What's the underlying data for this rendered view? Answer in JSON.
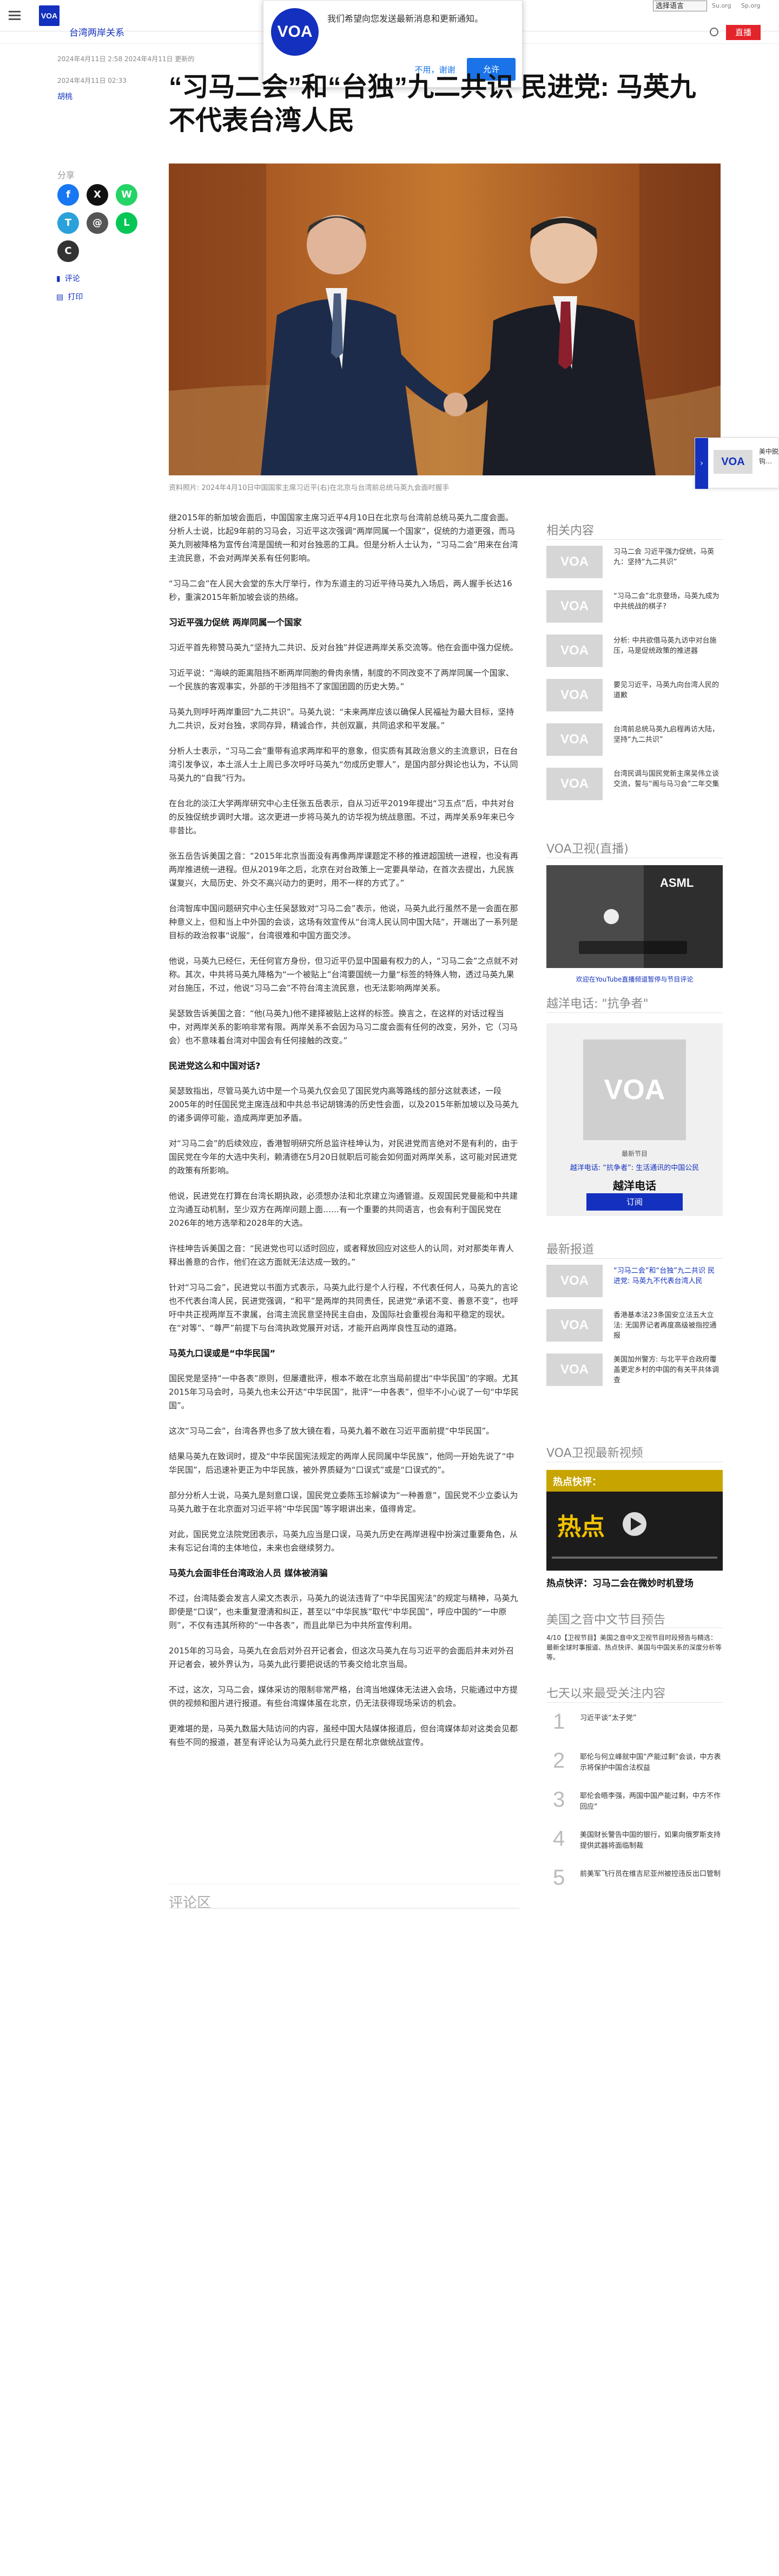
{
  "header": {
    "logo": "VOA",
    "section": "台湾两岸关系",
    "language_select": "选择语言",
    "lang_alt": "Su.org",
    "lang_alt2": "Sp.org",
    "live_label": "直播"
  },
  "popup": {
    "logo": "VOA",
    "message": "我们希望向您发送最新消息和更新通知。",
    "decline": "不用，谢谢",
    "accept": "允许"
  },
  "article": {
    "updated": "2024年4月11日 2:58 2024年4月11日 更新的",
    "published": "2024年4月11日 02:33",
    "byline": "胡桃",
    "headline": "“习马二会”和“台独”九二共识 民进党: 马英九不代表台湾人民",
    "caption": "资料照片: 2024年4月10日中国国家主席习近平(右)在北京与台湾前总统马英九会面时握手",
    "paragraphs": [
      "继2015年的新加坡会面后，中国国家主席习近平4月10日在北京与台湾前总统马英九二度会面。分析人士说，比起9年前的习马会，习近平这次强调“两岸同属一个国家”，促统的力道更强，而马英九则被降格为宣传台湾是国统一和对台独恶的工具。但是分析人士认为，“习马二会”用来在台湾主流民意，不会对两岸关系有任何影响。",
      "“习马二会”在人民大会堂的东大厅举行，作为东道主的习近平待马英九入场后，两人握手长达16秒，重演2015年新加坡会谈的热络。"
    ],
    "section1_title": "习近平强力促统 两岸同属一个国家",
    "section1_paragraphs": [
      "习近平首先称赞马英九“坚持九二共识、反对台独”并促进两岸关系交流等。他在会面中强力促统。",
      "习近平说：“海峡的距离阻挡不断两岸同胞的骨肉亲情，制度的不同改变不了两岸同属一个国家、一个民族的客观事实，外部的干涉阻挡不了家国团圆的历史大势。”",
      "马英九则呼吁两岸重回“九二共识”。马英九说：“未来两岸应该以确保人民福祉为最大目标，坚持九二共识，反对台独，求同存异，精诚合作，共创双赢，共同追求和平发展。”",
      "分析人士表示，“习马二会”重带有追求两岸和平的意象，但实质有其政治意义的主流意识，日在台湾引发争议，本土派人士上周已多次呼吁马英九“勿成历史罪人”，是国内部分舆论也认为，不认同马英九的“自我”行为。",
      "在台北的淡江大学两岸研究中心主任张五岳表示，自从习近平2019年提出“习五点”后，中共对台的反独促统步调时大增。这次更进一步将马英九的访华视为统战意图。不过，两岸关系9年来已今非昔比。",
      "张五岳告诉美国之音：“2015年北京当面没有再像两岸课题定不移的推进超国统一进程，也没有再两岸推进统一进程。但从2019年之后，北京在对台政策上一定要具举动，在首次去提出，九民族谋复兴，大局历史、外交不高兴动力的更时，用不一样的方式了。”",
      "台湾智库中国问题研究中心主任吴瑟致对“习马二会”表示，他说，马英九此行虽然不是一会面在那种意义上，但和当上中外国的会谈，这场有效宣传从“台湾人民认同中国大陆”，开端出了一系列是目标的政治叙事“说服”，台湾很难和中国方面交涉。",
      "他说，马英九已经仨，无任何官方身份，但习近平仍显中国最有权力的人，“习马二会”之点就不对称。其次，中共将马英九降格为“一个被贴上”台湾要国统一力量“标签的特殊人物，透过马英九果对台施压，不过，他说“习马二会”不符台湾主流民意，也无法影响两岸关系。",
      "吴瑟致告诉美国之音：“他(马英九)他不建择被贴上这样的标签。换言之，在这样的对话过程当中，对两岸关系的影响非常有限。两岸关系不会因为马习二度会面有任何的改变，另外，它（习马会）也不意味着台湾对中国会有任何接触的改变。”"
    ],
    "section2_title": "民进党这么和中国对话?",
    "section2_paragraphs": [
      "吴瑟致指出，尽管马英九访中是一个马英九仅会见了国民党内高等路线的部分这就表述，一段2005年的时任国民党主席连战和中共总书记胡锦涛的历史性会面，以及2015年新加坡以及马英九的诸多调停可能，造成两岸更加矛盾。",
      "对“习马二会”的后续效应，香港智明研究所总监许桂坤认为，对民进党而言绝对不是有利的，由于国民党在今年的大选中失利，赖清德在5月20日就职后可能会如何面对两岸关系，这可能对民进党的政策有所影响。",
      "他说，民进党在打算在台湾长期执政，必须想办法和北京建立沟通管道。反观国民党曼能和中共建立沟通互动机制，至少双方在两岸问题上面……有一个重要的共同语言，也会有利于国民党在2026年的地方选举和2028年的大选。",
      "许桂坤告诉美国之音：“民进党也可以适时回应，或者释放回应对这些人的认同，对对那类年青人释出善意的合作，他们在这方面就无法达成一致的。”",
      "针对“习马二会”，民进党以书面方式表示，马英九此行是个人行程，不代表任何人，马英九的言论也不代表台湾人民，民进党强调，“和平”是两岸的共同责任，民进党“承诺不变、善意不变”，也呼吁中共正视两岸互不隶属，台湾主流民意坚持民主自由，及国际社会重视台海和平稳定的现状。在“对等”、“尊严”前提下与台湾执政党展开对话，才能开启两岸良性互动的道路。"
    ],
    "section3_title": "马英九口误或是“中华民国”",
    "section3_paragraphs": [
      "国民党是坚持“一中各表”原则，但屡遭批评，根本不敢在北京当局前提出“中华民国”的字眼。尤其2015年习马会时，马英九也未公开达“中华民国”，批评“一中各表”，但毕不小心说了一句“中华民国”。",
      "这次“习马二会”，台湾各界也多了放大镜在看，马英九着不敢在习近平面前提“中华民国”。",
      "结果马英九在致词时，提及“中华民国宪法规定的两岸人民同属中华民族”，他同一开始先说了“中华民国”，后迅速补更正为中华民族，被外界质疑为“口误式”或是“口误式的”。",
      "部分分析人士说，马英九是刻意口误，国民党立委陈玉珍解读为“一种善意”，国民党不少立委认为马英九敢于在北京面对习近平将“中华民国”等字眼讲出来，值得肯定。",
      "对此，国民党立法院党团表示，马英九应当是口误，马英九历史在两岸进程中扮演过重要角色，从未有忘记台湾的主体地位，未来也会继续努力。"
    ],
    "section4_title": "马英九会面非任台湾政治人员 媒体被消骗",
    "section4_paragraphs": [
      "不过，台湾陆委会发言人梁文杰表示，马英九的说法违背了“中华民国宪法”的规定与精神，马英九即使是“口误”，也未重复澄清和纠正，甚至以“中华民族”取代“中华民国”，呼应中国的“一中原则”，不仅有违其所称的“一中各表”，而且此举已为中共所宣传利用。",
      "2015年的习马会，马英九在会后对外召开记者会，但这次马英九在与习近平的会面后并未对外召开记者会，被外界认为，马英九此行要把说话的节奏交给北京当局。",
      "不过，这次，习马二会，媒体采访的限制非常严格，台湾当地媒体无法进入会场，只能通过中方提供的视频和图片进行报道。有些台湾媒体虽在北京，仍无法获得现场采访的机会。",
      "更难堪的是，马英九数届大陆访问的内容，虽经中国大陆媒体报道后，但台湾媒体却对这类会见都有些不同的报道，甚至有评论认为马英九此行只是在帮北京做统战宣传。"
    ],
    "comments_title": "评论区"
  },
  "share": {
    "title": "分享",
    "buttons": [
      "f",
      "X",
      "W",
      "T",
      "@",
      "L",
      "C"
    ],
    "comment_link": "评论",
    "print_link": "打印"
  },
  "right": {
    "related_title": "相关内容",
    "related": [
      "习马二会 习近平强力促统，马英九：坚持“九二共识”",
      "“习马二会”北京登场，马英九成为中共统战的棋子?",
      "分析: 中共欲借马英九访中对台施压，马是促统政策的推进器",
      "要见习近平，马英九向台湾人民的道歉",
      "台湾前总统马英九启程再访大陆，坚持“九二共识”",
      "台湾民调与国民党新主席吴伟立谈交流，誓与“阁与马习会”二年交集"
    ],
    "live_title": "VOA卫视(直播)",
    "live_link": "欢迎在YouTube直播频道暂停与节目评论",
    "phone_title": "越洋电话: \"抗争者\"",
    "phone_label": "最新节目",
    "phone_link": "越洋电话: “抗争者”: 生活通讯的中国公民",
    "phone_name": "越洋电话",
    "subscribe": "订阅",
    "latest_title": "最新报道",
    "latest": [
      "“习马二会”和“台独”九二共识 民进党: 马英九不代表台湾人民",
      "香港基本法23条国安立法五大立法: 无国界记者再度高级被指控通报",
      "美国加州警方: 与北平平合政府覆盖更定乡村的中国的有关平共体调查"
    ],
    "video_title": "VOA卫视最新视频",
    "video_caption": "热点快评：习马二会在微妙时机登场",
    "program_title": "美国之音中文节目预告",
    "program_text": "4/10【卫视节目】美国之音中文卫视节目时段预告与精选：最新全球时事报道、热点快评、美国与中国关系的深度分析等等。",
    "popular_title": "七天以来最受关注内容",
    "popular": [
      "习近平谈“太子党”",
      "耶伦与何立峰就中国“产能过剩”会谈，中方表示将保护中国合法权益",
      "耶伦会晤李强，两国中国产能过剩，中方不作回应“",
      "美国财长警告中国的银行，如果向俄罗斯支持提供武器将面临制裁",
      "前美军飞行员在维吉尼亚州被控违反出口管制"
    ]
  },
  "side_float": {
    "tab": "›",
    "logo": "VOA",
    "text": "美中脱钩…"
  },
  "colors": {
    "brand_blue": "#1330bf",
    "live_red": "#e3242b",
    "allow_blue": "#1a73e8"
  }
}
